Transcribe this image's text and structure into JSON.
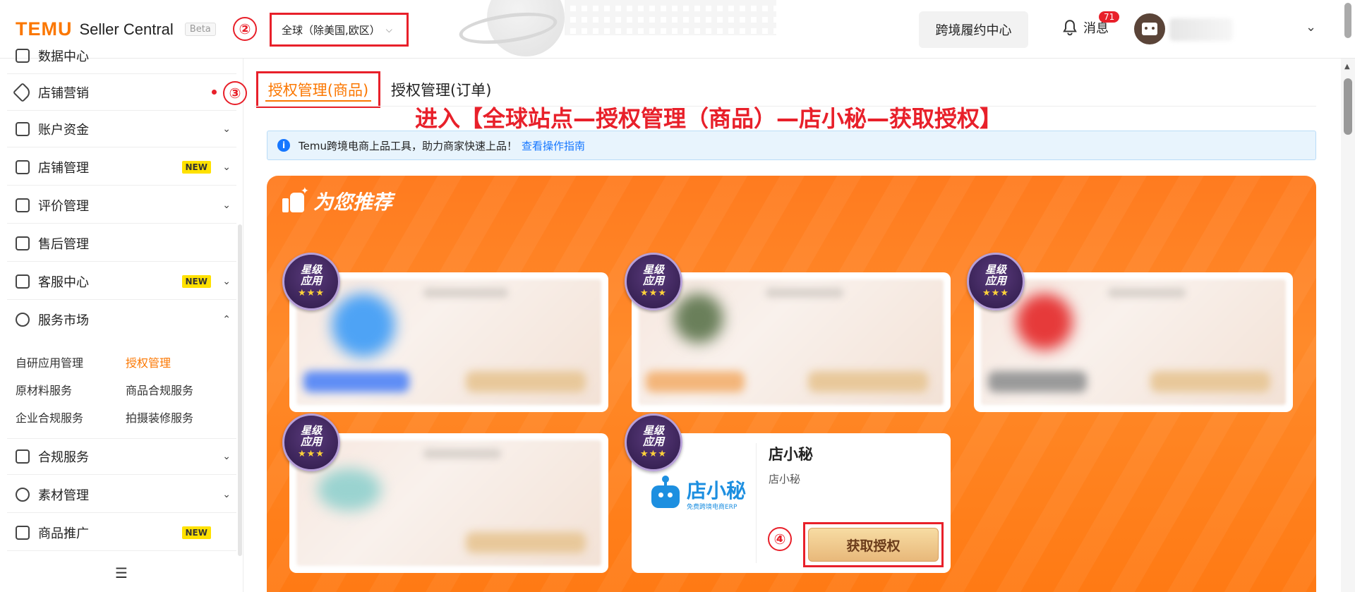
{
  "header": {
    "logo_brand": "TEMU",
    "logo_product": "Seller Central",
    "logo_beta": "Beta",
    "step2": "②",
    "site_selector": "全球（除美国,欧区）",
    "fulfillment_center": "跨境履约中心",
    "messages_label": "消息",
    "messages_count": "71"
  },
  "sidebar": {
    "items": [
      {
        "label": "数据中心"
      },
      {
        "label": "店铺营销"
      },
      {
        "label": "账户资金"
      },
      {
        "label": "店铺管理",
        "badge": "NEW"
      },
      {
        "label": "评价管理"
      },
      {
        "label": "售后管理"
      },
      {
        "label": "客服中心",
        "badge": "NEW"
      },
      {
        "label": "服务市场"
      },
      {
        "label": "合规服务"
      },
      {
        "label": "素材管理"
      },
      {
        "label": "商品推广",
        "badge": "NEW"
      }
    ],
    "sub_links": [
      "自研应用管理",
      "授权管理",
      "原材料服务",
      "商品合规服务",
      "企业合规服务",
      "拍摄装修服务"
    ],
    "step3": "③"
  },
  "main": {
    "tabs": [
      "授权管理(商品)",
      "授权管理(订单)"
    ],
    "instruction": "进入【全球站点—授权管理（商品）—店小秘—获取授权】",
    "banner_text": "Temu跨境电商上品工具，助力商家快速上品！",
    "banner_link": "查看操作指南",
    "recommend_title": "为您推荐",
    "star_badge_line1": "星级",
    "star_badge_line2": "应用",
    "stars": "★★★",
    "featured_card": {
      "logo_text": "店小秘",
      "logo_sub": "免费跨境电商ERP",
      "title": "店小秘",
      "subtitle": "店小秘",
      "button": "获取授权",
      "step4": "④"
    }
  },
  "colors": {
    "brand_orange": "#fb7701",
    "annotation_red": "#e8202a",
    "link_blue": "#1677ff",
    "panel_orange": "#ff7b1f"
  }
}
